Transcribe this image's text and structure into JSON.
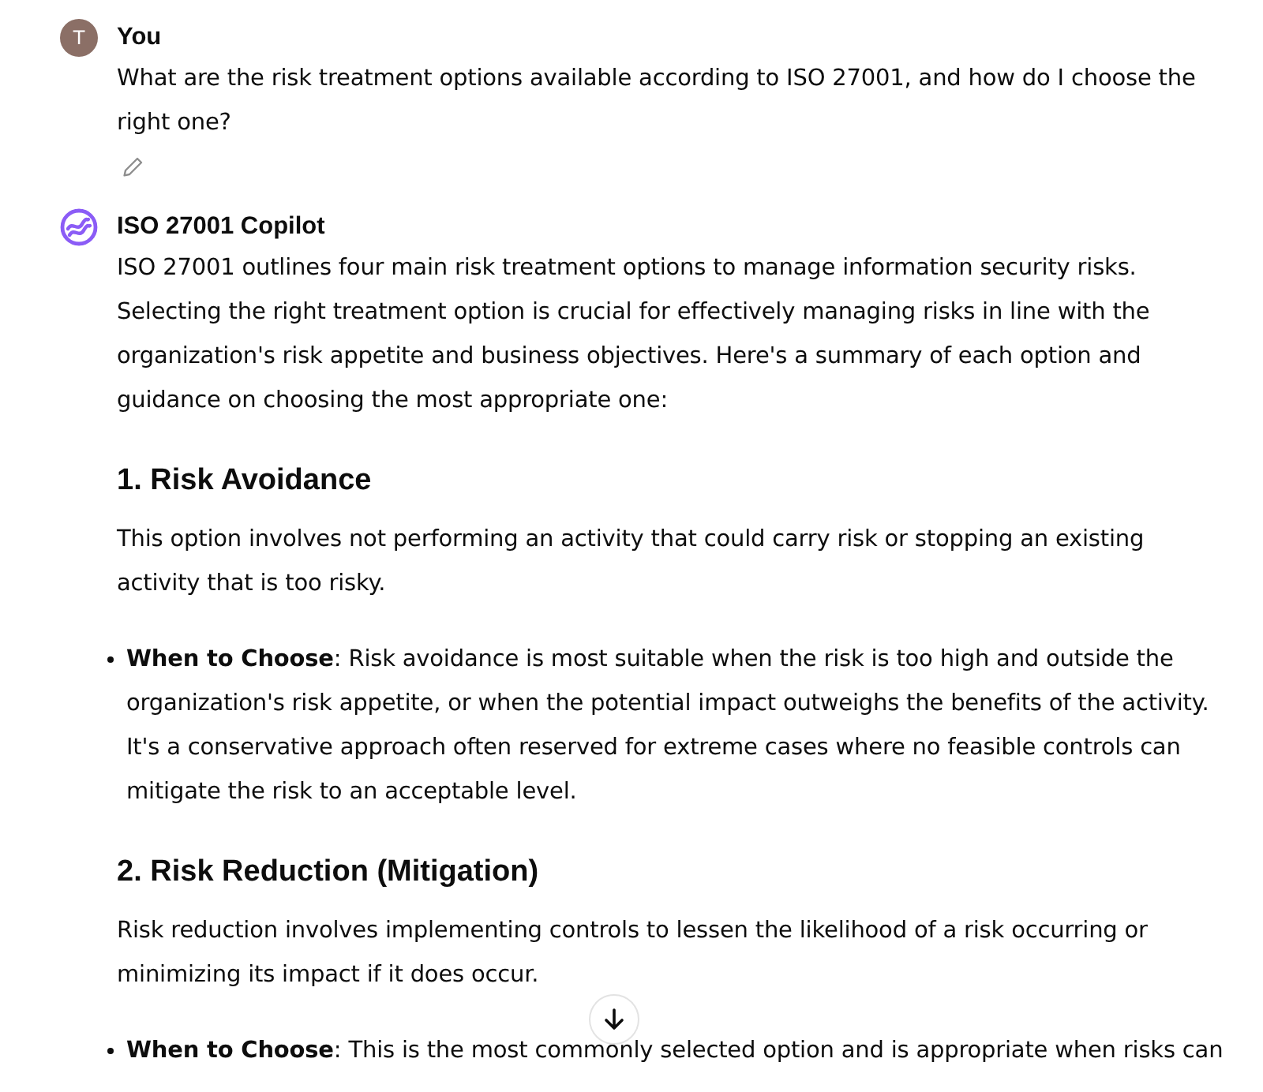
{
  "messages": [
    {
      "author": "You",
      "avatar": {
        "kind": "letter",
        "letter": "T"
      },
      "editable": true,
      "blocks": [
        {
          "kind": "paragraph",
          "text": "What are the risk treatment options available according to ISO 27001, and how do I choose the right one?"
        }
      ]
    },
    {
      "author": "ISO 27001 Copilot",
      "avatar": {
        "kind": "logo"
      },
      "editable": false,
      "blocks": [
        {
          "kind": "paragraph",
          "text": "ISO 27001 outlines four main risk treatment options to manage information security risks. Selecting the right treatment option is crucial for effectively managing risks in line with the organization's risk appetite and business objectives. Here's a summary of each option and guidance on choosing the most appropriate one:"
        },
        {
          "kind": "heading",
          "text": "1. Risk Avoidance"
        },
        {
          "kind": "paragraph",
          "text": "This option involves not performing an activity that could carry risk or stopping an existing activity that is too risky."
        },
        {
          "kind": "bullet",
          "text": "**When to Choose**: Risk avoidance is most suitable when the risk is too high and outside the organization's risk appetite, or when the potential impact outweighs the benefits of the activity. It's a conservative approach often reserved for extreme cases where no feasible controls can mitigate the risk to an acceptable level."
        },
        {
          "kind": "heading",
          "text": "2. Risk Reduction (Mitigation)"
        },
        {
          "kind": "paragraph",
          "text": "Risk reduction involves implementing controls to lessen the likelihood of a risk occurring or minimizing its impact if it does occur."
        },
        {
          "kind": "bullet",
          "text": "**When to Choose**: This is the most commonly selected option and is appropriate when risks can"
        }
      ]
    }
  ]
}
